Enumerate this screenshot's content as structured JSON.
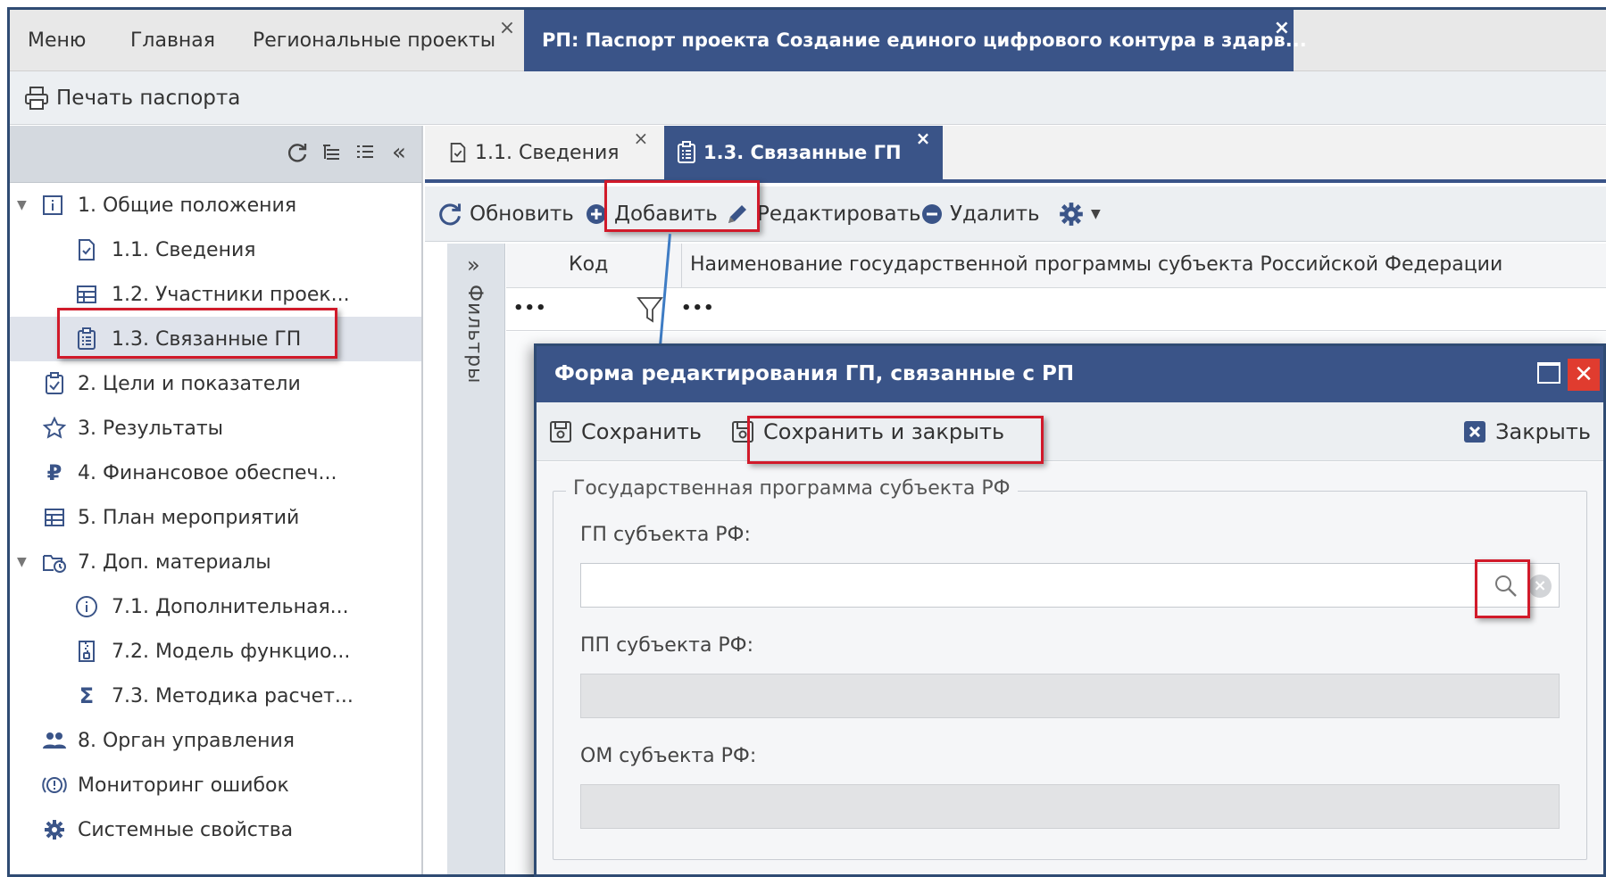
{
  "top_tabs": {
    "menu": "Меню",
    "home": "Главная",
    "regional_projects": "Региональные проекты",
    "passport": "РП: Паспорт проекта Создание единого цифрового контура в здарв..."
  },
  "print_bar": {
    "print_label": "Печать паспорта"
  },
  "tree": {
    "items": [
      {
        "label": "1. Общие положения"
      },
      {
        "label": "1.1. Сведения"
      },
      {
        "label": "1.2. Участники проек..."
      },
      {
        "label": "1.3. Связанные ГП"
      },
      {
        "label": "2. Цели и показатели"
      },
      {
        "label": "3. Результаты"
      },
      {
        "label": "4. Финансовое обеспеч..."
      },
      {
        "label": "5. План мероприятий"
      },
      {
        "label": "7. Доп. материалы"
      },
      {
        "label": "7.1. Дополнительная..."
      },
      {
        "label": "7.2. Модель функцио..."
      },
      {
        "label": "7.3. Методика расчет..."
      },
      {
        "label": "8. Орган управления"
      },
      {
        "label": "Мониторинг ошибок"
      },
      {
        "label": "Системные свойства"
      }
    ]
  },
  "content_tabs": {
    "info": "1.1. Сведения",
    "related": "1.3. Связанные ГП"
  },
  "toolbar": {
    "refresh": "Обновить",
    "add": "Добавить",
    "edit": "Редактировать",
    "delete": "Удалить"
  },
  "filters": {
    "label": "Фильтры"
  },
  "grid": {
    "columns": [
      "Код",
      "Наименование государственной программы субъекта Российской Федерации"
    ],
    "filter_dots": "•••"
  },
  "modal": {
    "title": "Форма редактирования ГП, связанные с РП",
    "save": "Сохранить",
    "save_close": "Сохранить и закрыть",
    "close": "Закрыть",
    "fieldset_legend": "Государственная программа субъекта РФ",
    "fields": [
      {
        "label": "ГП субъекта РФ:",
        "value": ""
      },
      {
        "label": "ПП субъекта РФ:",
        "value": ""
      },
      {
        "label": "ОМ субъекта РФ:",
        "value": ""
      }
    ]
  },
  "colors": {
    "accent": "#3a5488",
    "highlight": "#d11a2a",
    "connector": "#3e7cc4",
    "close_red": "#e03c2f"
  }
}
